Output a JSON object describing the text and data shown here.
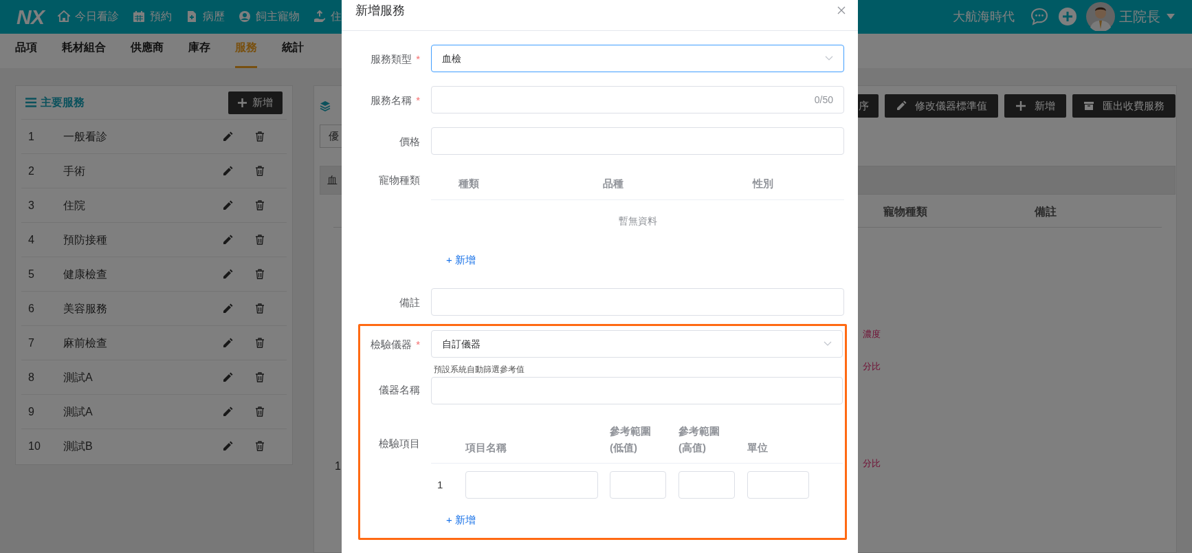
{
  "top_bar": {
    "logo": "NX",
    "nav": [
      {
        "kind": "home",
        "label": "今日看診"
      },
      {
        "kind": "calendar",
        "label": "預約"
      },
      {
        "kind": "file",
        "label": "病歷"
      },
      {
        "kind": "user",
        "label": "飼主寵物"
      },
      {
        "kind": "inpatient",
        "label": "住"
      }
    ],
    "org": "大航海時代",
    "user": "王院長"
  },
  "sub_nav": [
    {
      "label": "品項",
      "selected": false
    },
    {
      "label": "耗材組合",
      "selected": false
    },
    {
      "label": "供應商",
      "selected": false
    },
    {
      "label": "庫存",
      "selected": false
    },
    {
      "label": "服務",
      "selected": true
    },
    {
      "label": "統計",
      "selected": false
    }
  ],
  "main_services": {
    "title": "主要服務",
    "add_button": "新增",
    "rows": [
      {
        "index": "1",
        "name": "一般看診"
      },
      {
        "index": "2",
        "name": "手術"
      },
      {
        "index": "3",
        "name": "住院"
      },
      {
        "index": "4",
        "name": "預防接種"
      },
      {
        "index": "5",
        "name": "健康檢查"
      },
      {
        "index": "6",
        "name": "美容服務"
      },
      {
        "index": "7",
        "name": "麻前檢查"
      },
      {
        "index": "8",
        "name": "測試A"
      },
      {
        "index": "9",
        "name": "測試A"
      },
      {
        "index": "10",
        "name": "測試B"
      }
    ]
  },
  "services_panel": {
    "buttons": [
      {
        "kind": "sort",
        "label": "序"
      },
      {
        "kind": "edit",
        "label": "修改儀器標準值"
      },
      {
        "kind": "add",
        "label": "新增"
      },
      {
        "kind": "export",
        "label": "匯出收費服務"
      }
    ],
    "filter": "優",
    "tab": "血",
    "columns": [
      "寵物種類",
      "備註"
    ],
    "row_index": "1",
    "fragments": [
      "濃度",
      "分比",
      "分比"
    ]
  },
  "modal": {
    "title": "新增服務",
    "fields": [
      {
        "kind": "select",
        "label": "服務類型",
        "required_mark": "*",
        "value": "血檢",
        "focused": true
      },
      {
        "kind": "text",
        "label": "服務名稱",
        "required_mark": "*",
        "counter": "0/50"
      },
      {
        "kind": "text",
        "label": "價格"
      },
      {
        "kind": "table",
        "label": "寵物種類",
        "columns": [
          "種類",
          "品種",
          "性別"
        ],
        "empty_text": "暫無資料",
        "add_link": "+ 新增"
      },
      {
        "kind": "text",
        "label": "備註"
      }
    ],
    "highlighted_fields": [
      {
        "kind": "select",
        "label": "檢驗儀器",
        "required_mark": "*",
        "value": "自訂儀器",
        "focused": false
      },
      {
        "kind": "text",
        "label": "儀器名稱",
        "hint": "預設系統自動篩選參考值"
      },
      {
        "kind": "items",
        "label": "檢驗項目",
        "columns": [
          "項目名稱",
          "參考範圍\n(低值)",
          "參考範圍\n(高值)",
          "單位"
        ],
        "rows": [
          {
            "index": "1"
          }
        ],
        "add_link": "+ 新增"
      }
    ]
  }
}
